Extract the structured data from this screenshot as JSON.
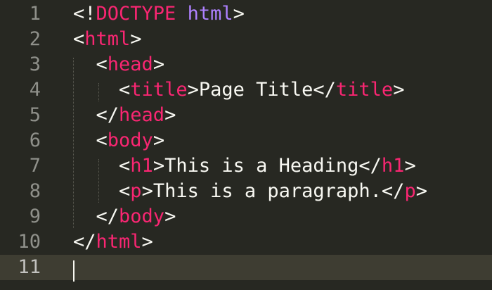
{
  "editor": {
    "line_numbers": [
      "1",
      "2",
      "3",
      "4",
      "5",
      "6",
      "7",
      "8",
      "9",
      "10",
      "11"
    ],
    "lines": [
      {
        "indent": "",
        "parts": [
          {
            "t": "punct",
            "v": "<!"
          },
          {
            "t": "doctype-kw",
            "v": "DOCTYPE"
          },
          {
            "t": "punct",
            "v": " "
          },
          {
            "t": "doctype-attr",
            "v": "html"
          },
          {
            "t": "punct",
            "v": ">"
          }
        ]
      },
      {
        "indent": "",
        "parts": [
          {
            "t": "punct",
            "v": "<"
          },
          {
            "t": "tag",
            "v": "html"
          },
          {
            "t": "punct",
            "v": ">"
          }
        ]
      },
      {
        "indent": "  ",
        "parts": [
          {
            "t": "punct",
            "v": "<"
          },
          {
            "t": "tag",
            "v": "head"
          },
          {
            "t": "punct",
            "v": ">"
          }
        ]
      },
      {
        "indent": "    ",
        "parts": [
          {
            "t": "punct",
            "v": "<"
          },
          {
            "t": "tag",
            "v": "title"
          },
          {
            "t": "punct",
            "v": ">Page Title</"
          },
          {
            "t": "tag",
            "v": "title"
          },
          {
            "t": "punct",
            "v": ">"
          }
        ]
      },
      {
        "indent": "  ",
        "parts": [
          {
            "t": "punct",
            "v": "</"
          },
          {
            "t": "tag",
            "v": "head"
          },
          {
            "t": "punct",
            "v": ">"
          }
        ]
      },
      {
        "indent": "  ",
        "parts": [
          {
            "t": "punct",
            "v": "<"
          },
          {
            "t": "tag",
            "v": "body"
          },
          {
            "t": "punct",
            "v": ">"
          }
        ]
      },
      {
        "indent": "    ",
        "parts": [
          {
            "t": "punct",
            "v": "<"
          },
          {
            "t": "tag",
            "v": "h1"
          },
          {
            "t": "punct",
            "v": ">This is a Heading</"
          },
          {
            "t": "tag",
            "v": "h1"
          },
          {
            "t": "punct",
            "v": ">"
          }
        ]
      },
      {
        "indent": "    ",
        "parts": [
          {
            "t": "punct",
            "v": "<"
          },
          {
            "t": "tag",
            "v": "p"
          },
          {
            "t": "punct",
            "v": ">This is a paragraph.</"
          },
          {
            "t": "tag",
            "v": "p"
          },
          {
            "t": "punct",
            "v": ">"
          }
        ]
      },
      {
        "indent": "  ",
        "parts": [
          {
            "t": "punct",
            "v": "</"
          },
          {
            "t": "tag",
            "v": "body"
          },
          {
            "t": "punct",
            "v": ">"
          }
        ]
      },
      {
        "indent": "",
        "parts": [
          {
            "t": "punct",
            "v": "</"
          },
          {
            "t": "tag",
            "v": "html"
          },
          {
            "t": "punct",
            "v": ">"
          }
        ]
      },
      {
        "indent": "",
        "parts": []
      }
    ],
    "current_line": "11",
    "colors": {
      "background": "#272822",
      "current_line": "#3e3d32",
      "text": "#f8f8f2",
      "tag": "#f92672",
      "attr": "#ae81ff",
      "gutter_text": "#8f908a"
    }
  }
}
